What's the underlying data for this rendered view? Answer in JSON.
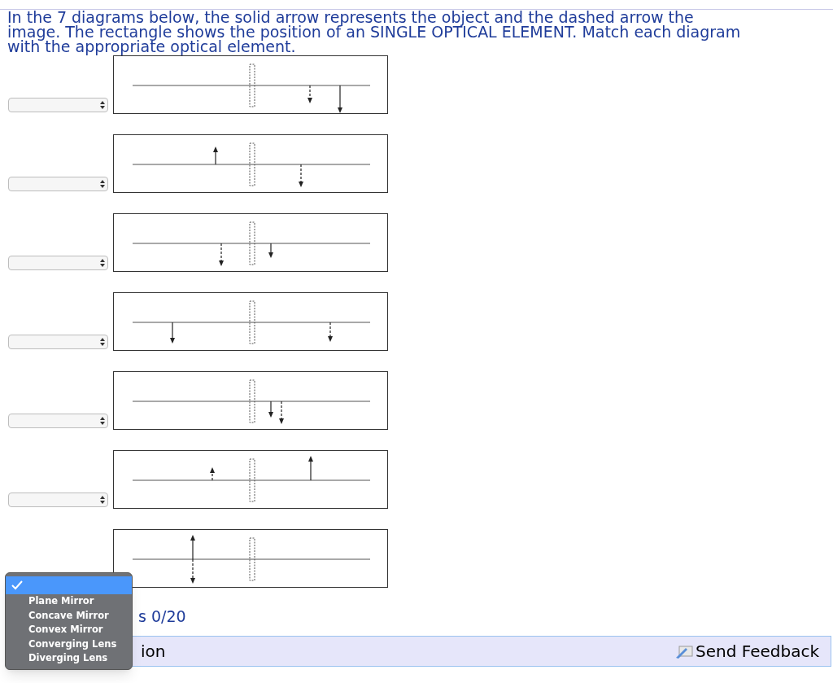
{
  "instructions": "In the 7 diagrams below, the solid arrow represents the object and the dashed arrow the image. The rectangle shows the position of an SINGLE OPTICAL ELEMENT. Match each diagram with the appropriate optical element.",
  "diagrams": [
    {
      "expanded": false
    },
    {
      "expanded": false
    },
    {
      "expanded": false
    },
    {
      "expanded": false
    },
    {
      "expanded": false
    },
    {
      "expanded": false
    },
    {
      "expanded": true
    }
  ],
  "dropdown_menu": {
    "options": [
      {
        "selected": true
      },
      {
        "label": "Plane Mirror",
        "selected": false
      },
      {
        "label": "Concave Mirror",
        "selected": false
      },
      {
        "label": "Convex Mirror",
        "selected": false
      },
      {
        "label": "Converging Lens",
        "selected": false
      },
      {
        "label": "Diverging Lens",
        "selected": false
      }
    ]
  },
  "score": "s 0/20",
  "footer": {
    "label": "ion",
    "feedback": "Send Feedback"
  }
}
